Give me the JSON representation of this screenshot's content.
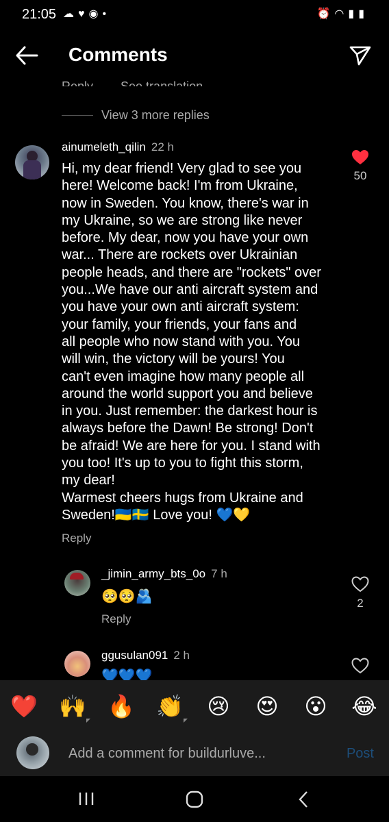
{
  "status_bar": {
    "time": "21:05",
    "left_icons": [
      "cloud-icon",
      "heart-icon",
      "messenger-icon",
      "dot-icon"
    ],
    "right_icons": [
      "alarm-icon",
      "wifi-icon",
      "signal-icon",
      "battery-icon"
    ]
  },
  "header": {
    "title": "Comments"
  },
  "cut_row": {
    "reply": "Reply",
    "see_translation": "See translation"
  },
  "view_more": "View 3 more replies",
  "comments": [
    {
      "username": "ainumeleth_qilin",
      "time": "22 h",
      "text": "Hi, my dear friend! Very glad to see you\nhere! Welcome back! I'm from Ukraine,\nnow in Sweden. You know, there's war in\nmy Ukraine, so we are strong like never\nbefore. My dear, now you have your own\nwar... There are rockets over Ukrainian\npeople heads, and there are \"rockets\" over\nyou...We have our anti aircraft system and\nyou have your own anti aircraft system:\nyour family, your friends, your fans and\nall people who now stand with you. You\nwill win, the victory will be yours! You\ncan't even imagine how many people all\naround the world support you and believe\nin you. Just remember: the darkest hour is\nalways before the Dawn! Be strong! Don't\nbe afraid! We are here for you. I stand with\nyou too! It's up to you to fight this storm,\nmy dear!\nWarmest cheers hugs from Ukraine and\nSweden!🇺🇦🇸🇪 Love you! 💙💛",
      "reply": "Reply",
      "likes": "50",
      "liked": true
    },
    {
      "username": "_jimin_army_bts_0o",
      "time": "7 h",
      "text": "🥺🥺🫂",
      "reply": "Reply",
      "likes": "2",
      "liked": false
    },
    {
      "username": "ggusulan091",
      "time": "2 h",
      "text": "💙💙💙",
      "liked": false
    }
  ],
  "reactions": [
    "❤️",
    "🙌",
    "🔥",
    "👏",
    "😢",
    "😍",
    "😮",
    "😂"
  ],
  "comment_input": {
    "placeholder": "Add a comment for buildurluve...",
    "post": "Post"
  },
  "colors": {
    "background": "#000000",
    "heart_red": "#ff3040",
    "post_blue": "#1d4e7a",
    "bar": "#1b1b1b"
  }
}
